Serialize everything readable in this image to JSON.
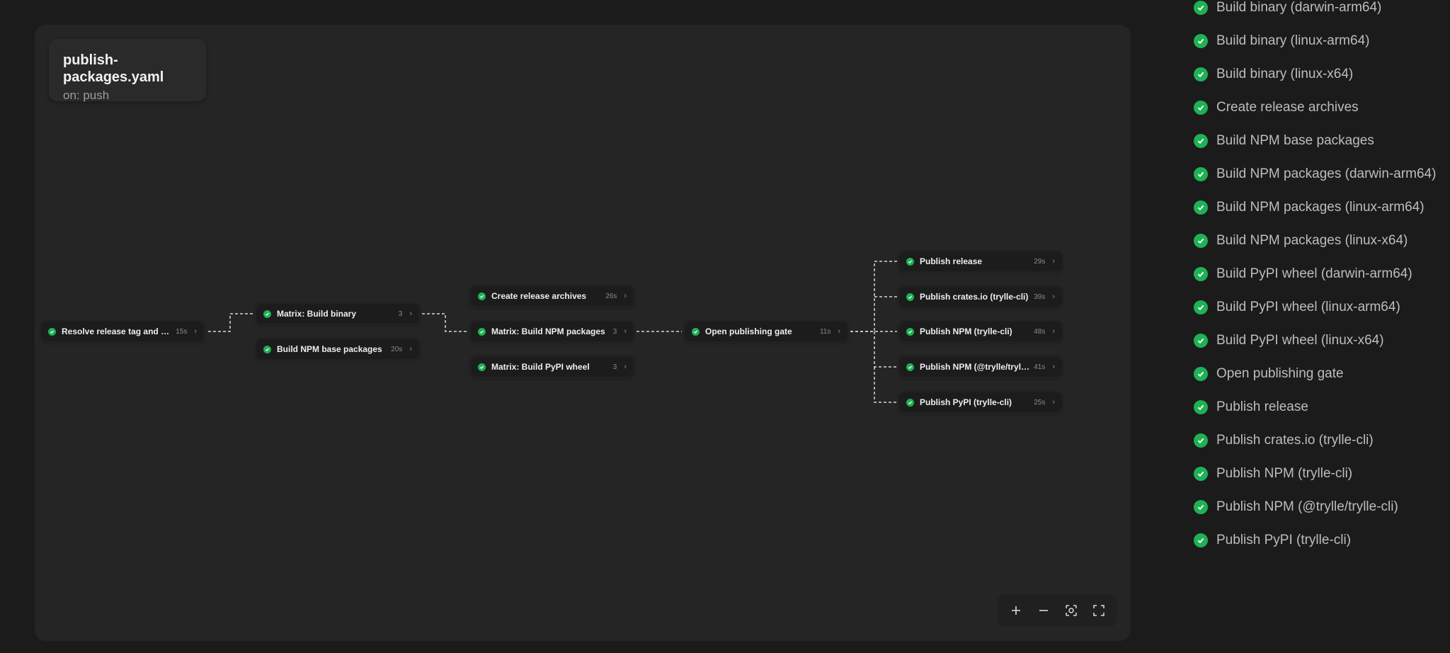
{
  "workflow": {
    "title": "publish-packages.yaml",
    "trigger": "on: push"
  },
  "nodes": {
    "resolve": {
      "label": "Resolve release tag and ver...",
      "meta": "15s"
    },
    "matrix_binary": {
      "label": "Matrix: Build binary",
      "meta": "3"
    },
    "npm_base": {
      "label": "Build NPM base packages",
      "meta": "20s"
    },
    "archives": {
      "label": "Create release archives",
      "meta": "26s"
    },
    "matrix_npm": {
      "label": "Matrix: Build NPM packages",
      "meta": "3"
    },
    "matrix_pypi": {
      "label": "Matrix: Build PyPI wheel",
      "meta": "3"
    },
    "gate": {
      "label": "Open publishing gate",
      "meta": "11s"
    },
    "publish_release": {
      "label": "Publish release",
      "meta": "29s"
    },
    "publish_crates": {
      "label": "Publish crates.io (trylle-cli)",
      "meta": "39s"
    },
    "publish_npm_cli": {
      "label": "Publish NPM (trylle-cli)",
      "meta": "48s"
    },
    "publish_npm_scoped": {
      "label": "Publish NPM (@trylle/trylle-...",
      "meta": "41s"
    },
    "publish_pypi": {
      "label": "Publish PyPI (trylle-cli)",
      "meta": "25s"
    }
  },
  "controls": {
    "zoom_in": "zoom-in-icon",
    "zoom_out": "zoom-out-icon",
    "fit_view": "focus-icon",
    "fullscreen": "fullscreen-icon"
  },
  "jobs": [
    "Build binary (darwin-arm64)",
    "Build binary (linux-arm64)",
    "Build binary (linux-x64)",
    "Create release archives",
    "Build NPM base packages",
    "Build NPM packages (darwin-arm64)",
    "Build NPM packages (linux-arm64)",
    "Build NPM packages (linux-x64)",
    "Build PyPI wheel (darwin-arm64)",
    "Build PyPI wheel (linux-arm64)",
    "Build PyPI wheel (linux-x64)",
    "Open publishing gate",
    "Publish release",
    "Publish crates.io (trylle-cli)",
    "Publish NPM (trylle-cli)",
    "Publish NPM (@trylle/trylle-cli)",
    "Publish PyPI (trylle-cli)"
  ],
  "colors": {
    "success": "#1fb155",
    "background": "#1b1b1b",
    "canvas": "#252525"
  }
}
